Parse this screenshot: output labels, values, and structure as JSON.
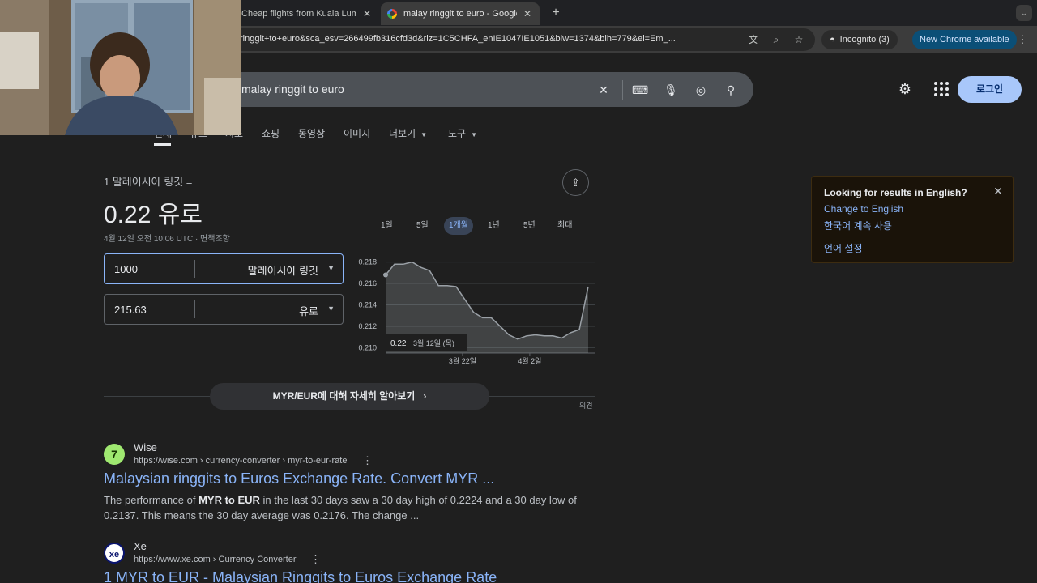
{
  "browser": {
    "tabs": [
      {
        "title": "Cheap flights from Kuala Lumpur",
        "active": false
      },
      {
        "title": "malay ringgit to euro - Google Search",
        "active": true
      }
    ],
    "url": "ringgit+to+euro&sca_esv=266499fb316cfd3d&rlz=1C5CHFA_enIE1047IE1051&biw=1374&bih=779&ei=Em_...",
    "incognito_label": "Incognito (3)",
    "update_label": "New Chrome available"
  },
  "google": {
    "query": "malay ringgit to euro",
    "login_label": "로그인",
    "nav_tabs": [
      "전체",
      "뉴스",
      "지도",
      "쇼핑",
      "동영상",
      "이미지",
      "더보기",
      "도구"
    ]
  },
  "currency": {
    "from_label": "1 말레이시아 링깃 =",
    "result": "0.22 유로",
    "timestamp": "4월 12일 오전 10:06 UTC · 면책조항",
    "input_1": {
      "value": "1000",
      "currency": "말레이시아 링깃"
    },
    "input_2": {
      "value": "215.63",
      "currency": "유로"
    },
    "ranges": [
      "1일",
      "5일",
      "1개월",
      "1년",
      "5년",
      "최대"
    ],
    "active_range": "1개월",
    "learn_more": "MYR/EUR에 대해 자세히 알아보기",
    "feedback": "의견"
  },
  "chart_data": {
    "type": "area",
    "x_ticks": [
      "3월 22일",
      "4월 2일"
    ],
    "y_ticks": [
      "0.218",
      "0.216",
      "0.214",
      "0.212",
      "0.210"
    ],
    "ylim": [
      0.2095,
      0.2185
    ],
    "grid": true,
    "values": [
      0.2168,
      0.2178,
      0.2178,
      0.218,
      0.2175,
      0.2172,
      0.2158,
      0.2158,
      0.2157,
      0.2145,
      0.2133,
      0.2128,
      0.2128,
      0.212,
      0.2112,
      0.2108,
      0.2111,
      0.2112,
      0.2111,
      0.2111,
      0.2109,
      0.2114,
      0.2117,
      0.2157
    ],
    "tooltip": {
      "value": "0.22",
      "date": "3월 12일 (목)"
    }
  },
  "results": [
    {
      "site": "Wise",
      "url": "https://wise.com › currency-converter › myr-to-eur-rate",
      "title": "Malaysian ringgits to Euros Exchange Rate. Convert MYR ...",
      "snippet_pre": "The performance of ",
      "snippet_bold": "MYR to EUR",
      "snippet_post": " in the last 30 days saw a 30 day high of 0.2224 and a 30 day low of 0.2137. This means the 30 day average was 0.2176. The change ..."
    },
    {
      "site": "Xe",
      "url": "https://www.xe.com › Currency Converter",
      "title": "1 MYR to EUR - Malaysian Ringgits to Euros Exchange Rate"
    }
  ],
  "lang_popup": {
    "title": "Looking for results in English?",
    "change": "Change to English",
    "continue": "한국어 계속 사용",
    "settings": "언어 설정"
  },
  "colors": {
    "accent": "#8ab4f8",
    "background": "#1f1f1f",
    "chart_line": "#9aa0a6",
    "login_bg": "#a8c7fa"
  }
}
